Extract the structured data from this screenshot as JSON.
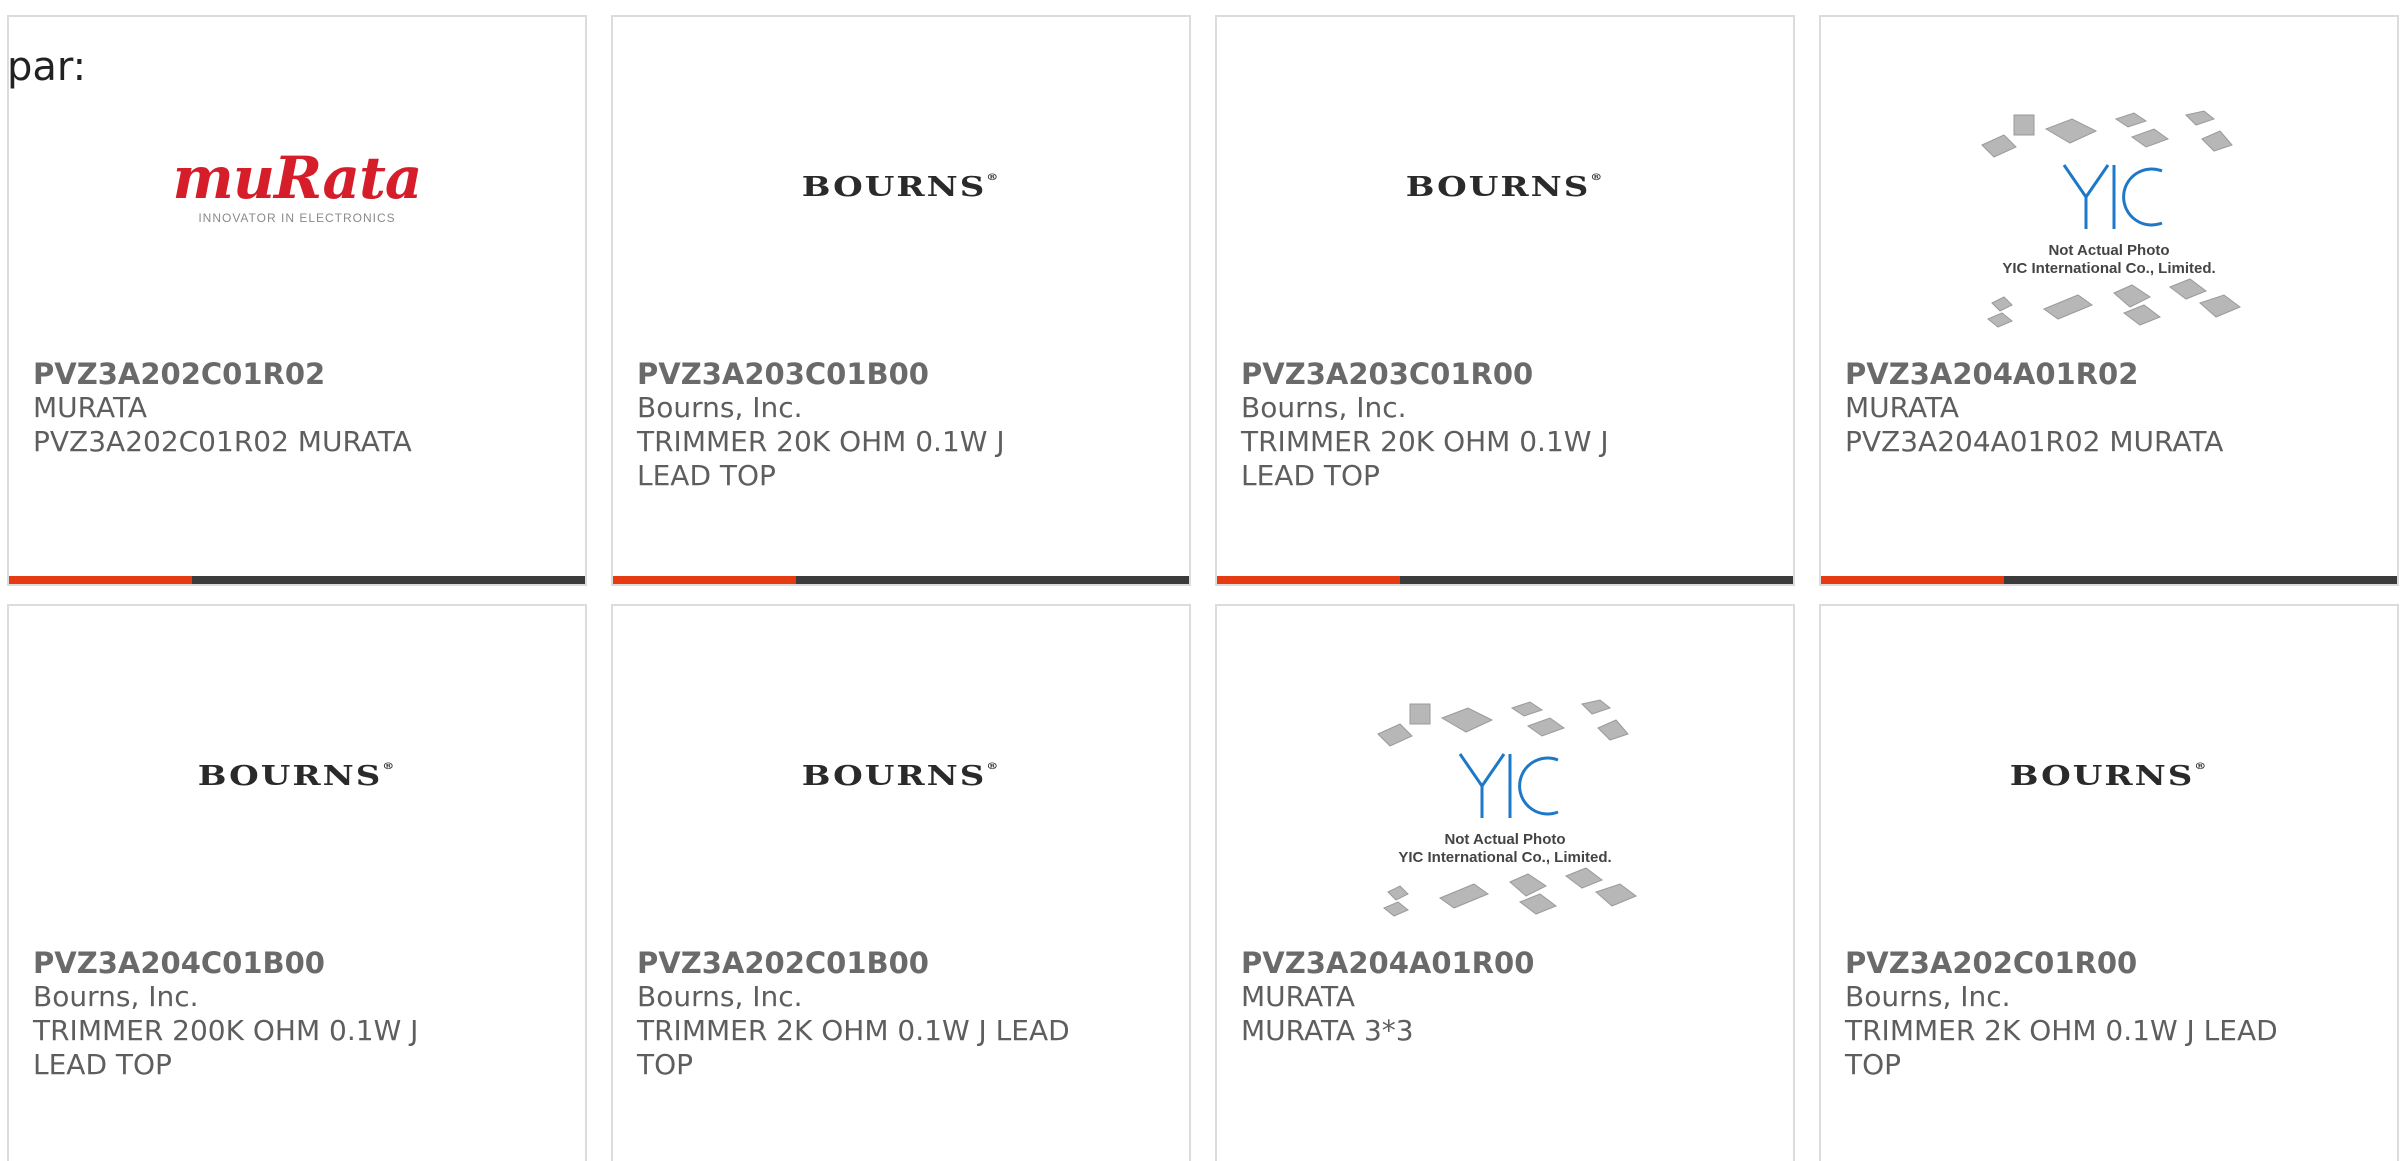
{
  "header": {
    "label": "par:"
  },
  "colors": {
    "accent": "#e63a12",
    "bar": "#3b3b3b",
    "murata_red": "#d61e2b",
    "yic_blue": "#1e78c8"
  },
  "cards": [
    {
      "part_number": "PVZ3A202C01R02",
      "manufacturer": "MURATA",
      "description": "PVZ3A202C01R02 MURATA",
      "logo": "murata",
      "logo_text": "muRata",
      "logo_tagline": "INNOVATOR IN ELECTRONICS"
    },
    {
      "part_number": "PVZ3A203C01B00",
      "manufacturer": "Bourns, Inc.",
      "description": "TRIMMER 20K OHM 0.1W J LEAD TOP",
      "logo": "bourns",
      "logo_text": "BOURNS"
    },
    {
      "part_number": "PVZ3A203C01R00",
      "manufacturer": "Bourns, Inc.",
      "description": "TRIMMER 20K OHM 0.1W J LEAD TOP",
      "logo": "bourns",
      "logo_text": "BOURNS"
    },
    {
      "part_number": "PVZ3A204A01R02",
      "manufacturer": "MURATA",
      "description": "PVZ3A204A01R02 MURATA",
      "logo": "yic",
      "logo_text": "YIC",
      "logo_line1": "Not Actual Photo",
      "logo_line2": "YIC International Co., Limited."
    },
    {
      "part_number": "PVZ3A204C01B00",
      "manufacturer": "Bourns, Inc.",
      "description": "TRIMMER 200K OHM 0.1W J LEAD TOP",
      "logo": "bourns",
      "logo_text": "BOURNS"
    },
    {
      "part_number": "PVZ3A202C01B00",
      "manufacturer": "Bourns, Inc.",
      "description": "TRIMMER 2K OHM 0.1W J LEAD TOP",
      "logo": "bourns",
      "logo_text": "BOURNS"
    },
    {
      "part_number": "PVZ3A204A01R00",
      "manufacturer": "MURATA",
      "description": "MURATA 3*3",
      "logo": "yic",
      "logo_text": "YIC",
      "logo_line1": "Not Actual Photo",
      "logo_line2": "YIC International Co., Limited."
    },
    {
      "part_number": "PVZ3A202C01R00",
      "manufacturer": "Bourns, Inc.",
      "description": "TRIMMER 2K OHM 0.1W J LEAD TOP",
      "logo": "bourns",
      "logo_text": "BOURNS"
    }
  ]
}
